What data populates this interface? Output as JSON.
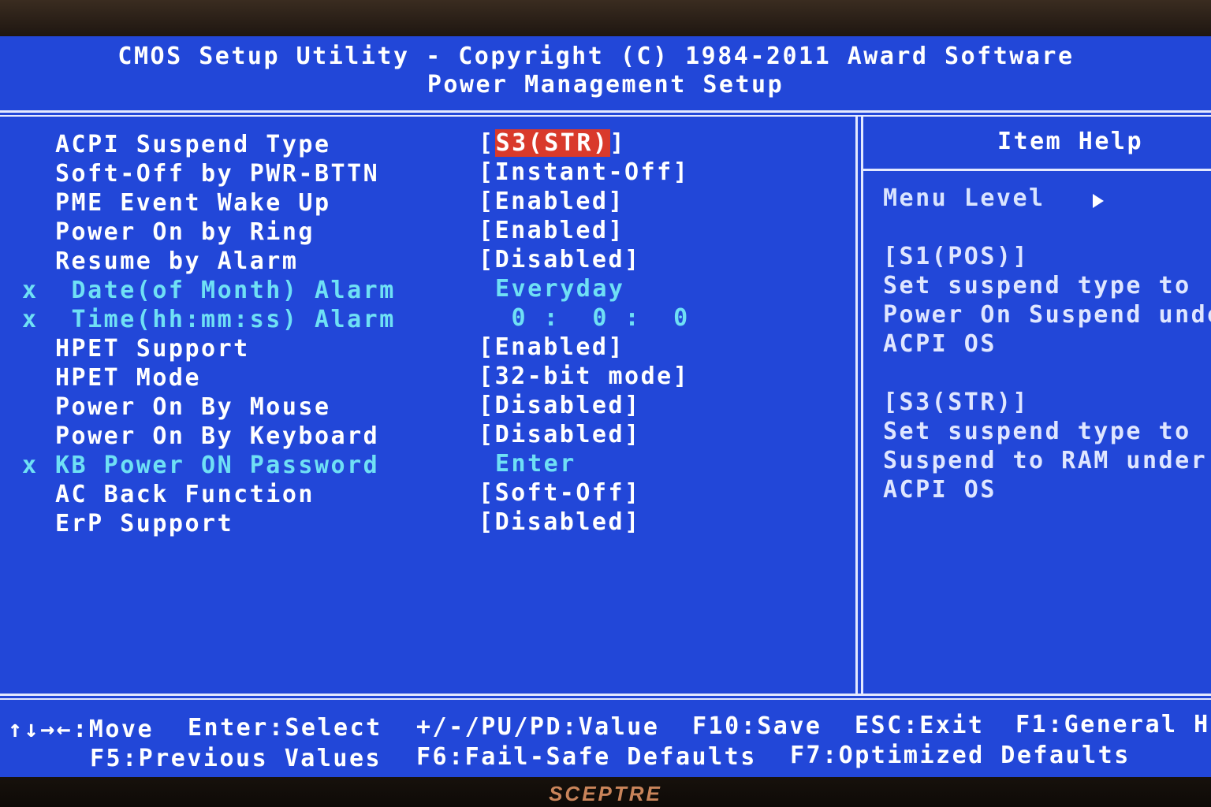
{
  "header": {
    "title": "CMOS Setup Utility - Copyright (C) 1984-2011 Award Software",
    "subtitle": "Power Management Setup"
  },
  "items": [
    {
      "label": "ACPI Suspend Type",
      "value_pre": "[",
      "value": "S3(STR)",
      "value_post": "]",
      "selected": true,
      "disabled": false
    },
    {
      "label": "Soft-Off by PWR-BTTN",
      "value_pre": "[",
      "value": "Instant-Off",
      "value_post": "]",
      "disabled": false
    },
    {
      "label": "PME Event Wake Up",
      "value_pre": "[",
      "value": "Enabled",
      "value_post": "]",
      "disabled": false
    },
    {
      "label": "Power On by Ring",
      "value_pre": "[",
      "value": "Enabled",
      "value_post": "]",
      "disabled": false
    },
    {
      "label": "Resume by Alarm",
      "value_pre": "[",
      "value": "Disabled",
      "value_post": "]",
      "disabled": false
    },
    {
      "label": " Date(of Month) Alarm",
      "value_pre": "",
      "value": "Everyday",
      "value_post": "",
      "disabled": true
    },
    {
      "label": " Time(hh:mm:ss) Alarm",
      "value_pre": "",
      "value": " 0 :  0 :  0",
      "value_post": "",
      "disabled": true
    },
    {
      "label": "HPET Support",
      "value_pre": "[",
      "value": "Enabled",
      "value_post": "]",
      "disabled": false
    },
    {
      "label": "HPET Mode",
      "value_pre": "[",
      "value": "32-bit mode",
      "value_post": "]",
      "disabled": false
    },
    {
      "label": "Power On By Mouse",
      "value_pre": "[",
      "value": "Disabled",
      "value_post": "]",
      "disabled": false
    },
    {
      "label": "Power On By Keyboard",
      "value_pre": "[",
      "value": "Disabled",
      "value_post": "]",
      "disabled": false
    },
    {
      "label": "KB Power ON Password",
      "value_pre": "",
      "value": "Enter",
      "value_post": "",
      "disabled": true
    },
    {
      "label": "AC Back Function",
      "value_pre": "[",
      "value": "Soft-Off",
      "value_post": "]",
      "disabled": false
    },
    {
      "label": "ErP Support",
      "value_pre": "[",
      "value": "Disabled",
      "value_post": "]",
      "disabled": false
    }
  ],
  "disabled_mark": "x",
  "help_panel": {
    "title": "Item Help",
    "menu_level": "Menu Level",
    "lines": [
      "[S1(POS)]",
      "Set suspend type to",
      "Power On Suspend under",
      "ACPI OS",
      "",
      "[S3(STR)]",
      "Set suspend type to",
      "Suspend to RAM under",
      "ACPI OS"
    ]
  },
  "footer": {
    "row1": [
      {
        "key": "↑↓→←",
        "action": ":Move"
      },
      {
        "key": "Enter",
        "action": ":Select"
      },
      {
        "key": "+/-/PU/PD",
        "action": ":Value"
      },
      {
        "key": "F10",
        "action": ":Save"
      },
      {
        "key": "ESC",
        "action": ":Exit"
      },
      {
        "key": "F1",
        "action": ":General Help"
      }
    ],
    "row2": [
      {
        "key": "F5",
        "action": ":Previous Values"
      },
      {
        "key": "F6",
        "action": ":Fail-Safe Defaults"
      },
      {
        "key": "F7",
        "action": ":Optimized Defaults"
      }
    ]
  },
  "monitor_brand": "SCEPTRE",
  "colors": {
    "screen_bg": "#2247d8",
    "text": "#ffffff",
    "disabled_text": "#6fe0f5",
    "selection_bg": "#d93a2b"
  }
}
